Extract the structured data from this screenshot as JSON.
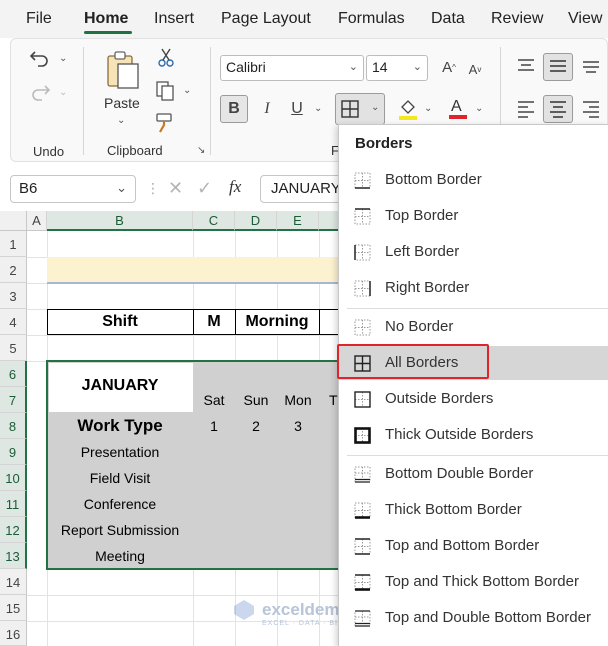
{
  "tabs": [
    "File",
    "Home",
    "Insert",
    "Page Layout",
    "Formulas",
    "Data",
    "Review",
    "View"
  ],
  "ribbon": {
    "undo_group": "Undo",
    "clipboard_group": "Clipboard",
    "font_group_partial": "F",
    "paste_label": "Paste",
    "font_name": "Calibri",
    "font_size": "14"
  },
  "formula_bar": {
    "name_box": "B6",
    "fx_label": "fx",
    "content": "JANUARY"
  },
  "columns": [
    "A",
    "B",
    "C",
    "D",
    "E"
  ],
  "rows": [
    "1",
    "2",
    "3",
    "4",
    "5",
    "6",
    "7",
    "8",
    "9",
    "10",
    "11",
    "12",
    "13",
    "14",
    "15",
    "16"
  ],
  "sheet": {
    "shift_label": "Shift",
    "m_label": "M",
    "morning_label": "Morning",
    "month": "JANUARY",
    "work_type_header": "Work Type",
    "days": [
      "Sat",
      "Sun",
      "Mon",
      "T"
    ],
    "dates": [
      "1",
      "2",
      "3"
    ],
    "work_types": [
      "Presentation",
      "Field Visit",
      "Conference",
      "Report Submission",
      "Meeting"
    ]
  },
  "borders_menu": {
    "title": "Borders",
    "items": [
      "Bottom Border",
      "Top Border",
      "Left Border",
      "Right Border",
      "No Border",
      "All Borders",
      "Outside Borders",
      "Thick Outside Borders",
      "Bottom Double Border",
      "Thick Bottom Border",
      "Top and Bottom Border",
      "Top and Thick Bottom Border",
      "Top and Double Bottom Border"
    ],
    "highlighted": "All Borders"
  },
  "watermark": {
    "brand": "exceldemy",
    "tagline": "EXCEL · DATA · BI"
  },
  "colors": {
    "accent": "#217346",
    "highlight_red": "#e0242b",
    "title_fill": "#fdf2d0",
    "table_fill": "#d0d0d0"
  }
}
